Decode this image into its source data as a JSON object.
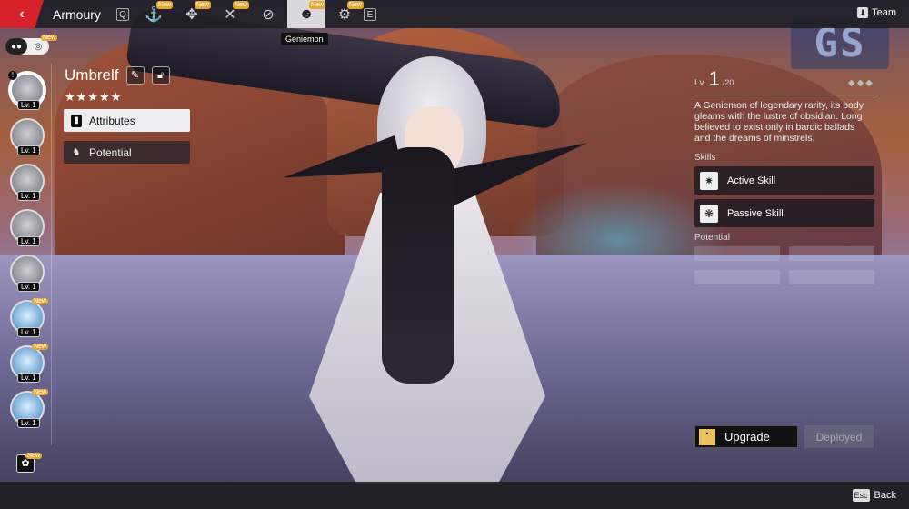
{
  "topbar": {
    "title": "Armoury",
    "left_key": "Q",
    "right_key": "E",
    "tabs": [
      {
        "icon": "anchor-icon",
        "glyph": "⚓",
        "new": "New"
      },
      {
        "icon": "cross-sword-icon",
        "glyph": "✥",
        "new": "New"
      },
      {
        "icon": "crossed-tools-icon",
        "glyph": "✕",
        "new": "New"
      },
      {
        "icon": "slash-circle-icon",
        "glyph": "⊘",
        "new": ""
      },
      {
        "icon": "geniemon-icon",
        "glyph": "☻",
        "new": "New"
      },
      {
        "icon": "gear-icon",
        "glyph": "⚙",
        "new": "New"
      }
    ],
    "tooltip": "Geniemon",
    "team_label": "Team"
  },
  "filter": {
    "new": "New"
  },
  "roster": [
    {
      "lv": "Lv. 1",
      "type": "grey",
      "new": "",
      "selected": true
    },
    {
      "lv": "Lv. 1",
      "type": "grey",
      "new": ""
    },
    {
      "lv": "Lv. 1",
      "type": "grey",
      "new": ""
    },
    {
      "lv": "Lv. 1",
      "type": "grey",
      "new": ""
    },
    {
      "lv": "Lv. 1",
      "type": "grey",
      "new": ""
    },
    {
      "lv": "Lv. 1",
      "type": "blue",
      "new": "New"
    },
    {
      "lv": "Lv. 1",
      "type": "blue",
      "new": "New"
    },
    {
      "lv": "Lv. 1",
      "type": "blue",
      "new": "New"
    }
  ],
  "roster_bottom_new": "New",
  "character": {
    "name": "Umbrelf",
    "stars": "★★★★★",
    "menu": {
      "attributes": "Attributes",
      "potential": "Potential"
    }
  },
  "details": {
    "level_label": "Lv.",
    "level": "1",
    "level_max": "/20",
    "rank": "◆◆◆",
    "description": "A Geniemon of legendary rarity, its body gleams with the lustre of obsidian. Long believed to exist only in bardic ballads and the dreams of minstrels.",
    "skills_label": "Skills",
    "skills": [
      "Active Skill",
      "Passive Skill"
    ],
    "potential_label": "Potential"
  },
  "actions": {
    "upgrade": "Upgrade",
    "deployed": "Deployed"
  },
  "footer": {
    "esc_key": "Esc",
    "back": "Back"
  },
  "watermark": "GS",
  "colors": {
    "accent": "#d6212a",
    "new_badge": "#e6a735",
    "upgrade_icon": "#e9c15a"
  }
}
